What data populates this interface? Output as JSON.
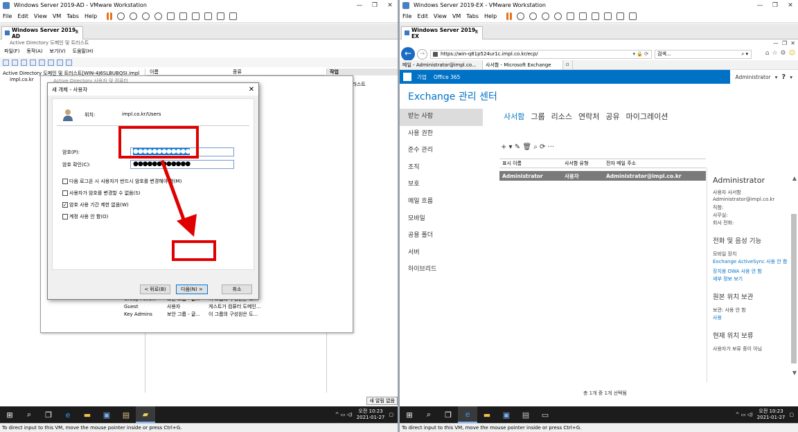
{
  "left": {
    "window_title": "Windows Server 2019-AD - VMware Workstation",
    "menu": [
      "File",
      "Edit",
      "View",
      "VM",
      "Tabs",
      "Help"
    ],
    "vm_tab": "Windows Server 2019-AD",
    "ad": {
      "title": "Active Directory 도메인 및 트러스트",
      "menu": [
        "파일(F)",
        "동작(A)",
        "보기(V)",
        "도움말(H)"
      ],
      "tree_root": "Active Directory 도메인 및 트러스트[WIN-4J6SLBUBQSI.impl",
      "tree_item": "impl.co.kr",
      "list_headers": [
        "이름",
        "종류"
      ],
      "actions_header": "작업",
      "actions_item": "트러스트",
      "status": "새 알림 없음"
    },
    "bg_window": {
      "title": "Active Directory 사용자 및 컴퓨터",
      "rows": [
        [
          "Group Polic...",
          "보안 그룹 - 글...",
          "이 그룹의 구성원은 도..."
        ],
        [
          "Guest",
          "사용자",
          "게스트가 컴퓨터 도메인..."
        ],
        [
          "Key Admins",
          "보안 그룹 - 글...",
          "이 그룹의 구성원은 도..."
        ]
      ]
    },
    "dialog": {
      "title": "새 개체 - 사용자",
      "location_label": "위치:",
      "location_value": "impl.co.kr/Users",
      "password_label": "암호(P):",
      "password_value": "●●●●●●●●●●●●",
      "confirm_label": "암호 확인(C):",
      "confirm_value": "●●●●●●●●●●●●",
      "options": [
        {
          "label": "다음 로그온 시 사용자가 반드시 암호를 변경해야 함(M)",
          "checked": false
        },
        {
          "label": "사용자가 암호를 변경할 수 없음(S)",
          "checked": false
        },
        {
          "label": "암호 사용 기간 제한 없음(W)",
          "checked": true
        },
        {
          "label": "계정 사용 안 함(O)",
          "checked": false
        }
      ],
      "back_button": "< 뒤로(B)",
      "next_button": "다음(N) >",
      "cancel_button": "취소"
    },
    "clock_time": "오전 10:23",
    "clock_date": "2021-01-27",
    "status_text": "To direct input to this VM, move the mouse pointer inside or press Ctrl+G."
  },
  "right": {
    "window_title": "Windows Server 2019-EX - VMware Workstation",
    "menu": [
      "File",
      "Edit",
      "View",
      "VM",
      "Tabs",
      "Help"
    ],
    "vm_tab": "Windows Server 2019-EX",
    "url": "https://win-q81p524ur1c.impl.co.kr/ecp/",
    "search_placeholder": "검색...",
    "tabs": [
      "메일 - Administrator@impl.co...",
      "사서함 - Microsoft Exchange"
    ],
    "o365_left": [
      "기업",
      "Office 365"
    ],
    "user": "Administrator",
    "help": "?",
    "title": "Exchange 관리 센터",
    "nav": [
      "받는 사람",
      "사용 권한",
      "준수 관리",
      "조직",
      "보호",
      "메일 흐름",
      "모바일",
      "공용 폴더",
      "서버",
      "하이브리드"
    ],
    "subnav": [
      "사서함",
      "그룹",
      "리소스",
      "연락처",
      "공유",
      "마이그레이션"
    ],
    "toolbar": "+ ▾  ✎  🗑  ⌕  ⟳  ···",
    "table_headers": [
      "표시 이름",
      "사서함 유형",
      "전자 메일 주소"
    ],
    "row": {
      "name": "Administrator",
      "type": "사용자",
      "email": "Administrator@impl.co.kr"
    },
    "count": "총 1개 중 1개 선택됨",
    "detail": {
      "name": "Administrator",
      "lines": [
        "사용자 사서함",
        "Administrator@impl.co.kr",
        "직함:",
        "사무실:",
        "회사 전화:"
      ],
      "h1": "전화 및 음성 기능",
      "mobile_label": "모바일 장치",
      "links": [
        "Exchange ActiveSync 사용 안 함",
        "장치용 OWA 사용 안 함",
        "세부 정보 보기"
      ],
      "h2": "원본 위치 보관",
      "archive": "보관: 사용 안 함",
      "archive_link": "사용",
      "h3": "현재 위치 보류",
      "hold": "사용자가 보류 중이 아님"
    },
    "clock_time": "오전 10:23",
    "clock_date": "2021-01-27",
    "status_text": "To direct input to this VM, move the mouse pointer inside or press Ctrl+G."
  },
  "colors": {
    "annotation_red": "#e00000",
    "exchange_blue": "#0072c6"
  }
}
